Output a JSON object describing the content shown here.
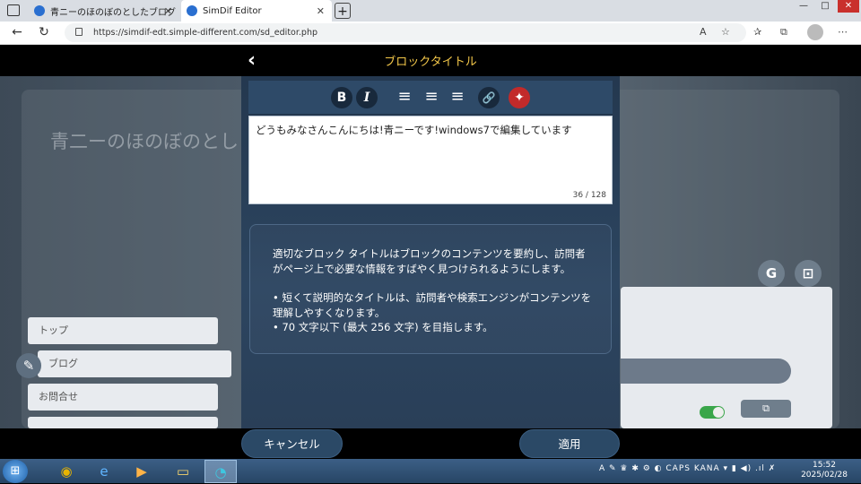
{
  "browser": {
    "tabs": [
      {
        "title": "青ニーのほのぼのとしたブログ"
      },
      {
        "title": "SimDif Editor"
      }
    ],
    "new_tab": "+",
    "url": "https://simdif-edt.simple-different.com/sd_editor.php",
    "window_controls": [
      "—",
      "□",
      "✕"
    ]
  },
  "editor_header": {
    "back": "‹",
    "title": "ブロックタイトル"
  },
  "background": {
    "site_title": "青二ーのほのぼのとし",
    "nav": [
      "トップ",
      "ブログ",
      "お問合せ"
    ]
  },
  "toolbar": {
    "bold": "B",
    "italic": "I",
    "align_left": "≡",
    "align_center": "≡",
    "align_right": "≡",
    "link": "🔗",
    "magic": "✦"
  },
  "editor": {
    "text": "どうもみなさんこんにちは!青ニーです!windows7で編集しています",
    "counter": "36 / 128"
  },
  "help": {
    "intro": "適切なブロック タイトルはブロックのコンテンツを要約し、訪問者がページ上で必要な情報をすばやく見つけられるようにします。",
    "bullets": [
      "• 短くて説明的なタイトルは、訪問者や検索エンジンがコンテンツを理解しやすくなります。",
      "• 70 文字以下 (最大 256 文字) を目指します。"
    ]
  },
  "buttons": {
    "cancel": "キャンセル",
    "apply": "適用"
  },
  "taskbar": {
    "clock_time": "15:52",
    "clock_date": "2025/02/28",
    "tray_text": "A ✎ ♛ ✱ ⚙ ◐ CAPS KANA ▾ ▮ ◀) .ıl ✗"
  },
  "colors": {
    "accent_title": "#f4c84a",
    "dialog_bg": "#2c4560",
    "pill_bg": "#2b4966"
  }
}
